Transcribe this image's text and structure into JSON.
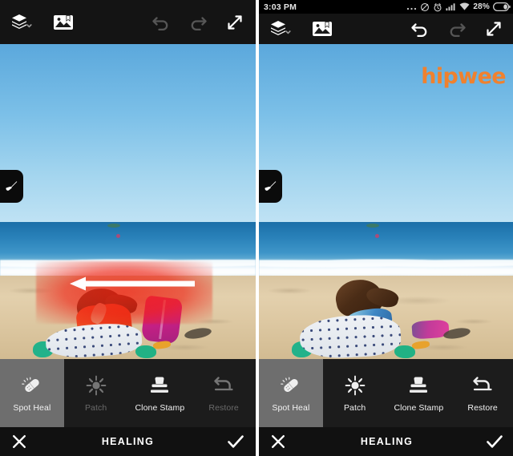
{
  "app": {
    "screen_title": "HEALING",
    "watermark": "hipwee",
    "accent_orange": "#f0812e",
    "active_tool_bg": "#6e6e6e",
    "heal_overlay_color": "#ee2212"
  },
  "status_bar": {
    "clock": "3:03 PM",
    "battery_percent": "28%",
    "icons": [
      "more-dots-icon",
      "do-not-disturb-icon",
      "alarm-clock-icon",
      "cellular-signal-icon",
      "wifi-icon",
      "battery-icon"
    ]
  },
  "toolbar_top": {
    "left_items": [
      {
        "name": "layers-button",
        "icon": "layers-icon",
        "label": "Layers",
        "has_chevron": true
      },
      {
        "name": "add-image-button",
        "icon": "image-bookmark-icon",
        "label": "Add Image"
      }
    ],
    "right_items": [
      {
        "name": "undo-button",
        "icon": "undo-icon",
        "label": "Undo"
      },
      {
        "name": "redo-button",
        "icon": "redo-icon",
        "label": "Redo"
      },
      {
        "name": "fullscreen-button",
        "icon": "expand-diagonal-icon",
        "label": "Fullscreen"
      }
    ]
  },
  "canvas": {
    "brush_tab_icon": "brush-icon",
    "brush_tab_label": "Brush settings",
    "photo_description": "Girl sitting on the beach with a pink backpack"
  },
  "tools": [
    {
      "name": "spot-heal",
      "label": "Spot Heal",
      "icon": "bandage-icon"
    },
    {
      "name": "patch",
      "label": "Patch",
      "icon": "patch-sparkle-icon"
    },
    {
      "name": "clone",
      "label": "Clone Stamp",
      "icon": "stamp-icon"
    },
    {
      "name": "restore",
      "label": "Restore",
      "icon": "restore-arrow-icon"
    }
  ],
  "bottom_bar": {
    "cancel_label": "Cancel",
    "cancel_icon": "close-x-icon",
    "confirm_label": "Apply",
    "confirm_icon": "checkmark-icon"
  },
  "panels": {
    "left": {
      "name": "before-panel",
      "caption": "Before — healing stroke being painted",
      "has_status_bar": false,
      "undo_enabled": false,
      "redo_enabled": false,
      "tool_states": {
        "spot-heal": "active",
        "patch": "dim",
        "clone": "normal",
        "restore": "dim"
      },
      "overlay_visible": true,
      "watermark_visible": false
    },
    "right": {
      "name": "after-panel",
      "caption": "After — healing applied",
      "has_status_bar": true,
      "undo_enabled": true,
      "redo_enabled": false,
      "tool_states": {
        "spot-heal": "active",
        "patch": "normal",
        "clone": "normal",
        "restore": "normal"
      },
      "overlay_visible": false,
      "watermark_visible": true
    }
  }
}
